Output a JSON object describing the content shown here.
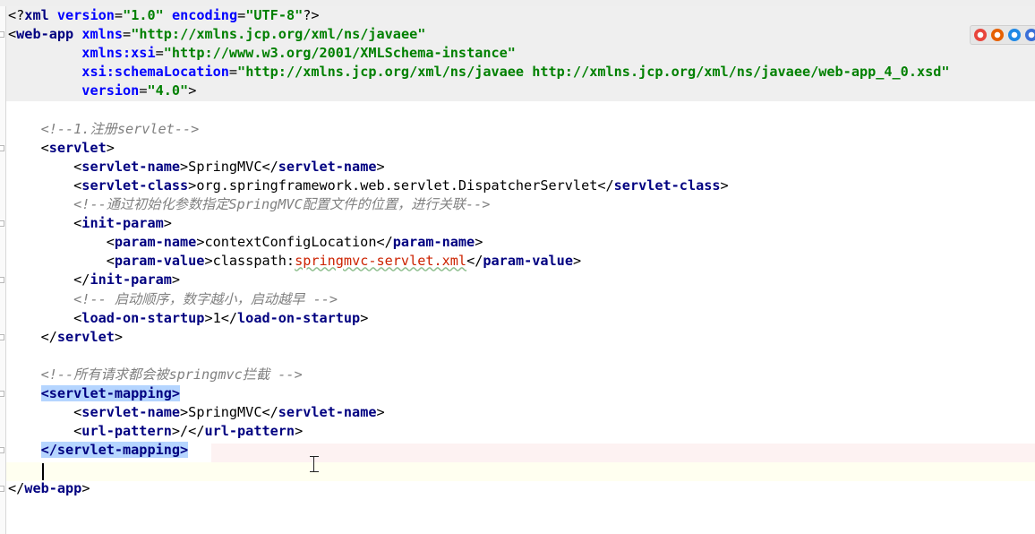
{
  "code_lines": [
    [
      {
        "s": "p",
        "t": "<?"
      },
      {
        "s": "t",
        "t": "xml"
      },
      {
        "s": "p",
        "t": " "
      },
      {
        "s": "a",
        "t": "version"
      },
      {
        "s": "p",
        "t": "="
      },
      {
        "s": "v",
        "t": "\"1.0\""
      },
      {
        "s": "p",
        "t": " "
      },
      {
        "s": "a",
        "t": "encoding"
      },
      {
        "s": "p",
        "t": "="
      },
      {
        "s": "v",
        "t": "\"UTF-8\""
      },
      {
        "s": "p",
        "t": "?>"
      }
    ],
    [
      {
        "s": "p",
        "t": "<"
      },
      {
        "s": "t",
        "t": "web-app"
      },
      {
        "s": "p",
        "t": " "
      },
      {
        "s": "a",
        "t": "xmlns"
      },
      {
        "s": "p",
        "t": "="
      },
      {
        "s": "v",
        "t": "\"http://xmlns.jcp.org/xml/ns/javaee\""
      }
    ],
    [
      {
        "s": "p",
        "t": "         "
      },
      {
        "s": "a",
        "t": "xmlns:xsi"
      },
      {
        "s": "p",
        "t": "="
      },
      {
        "s": "v",
        "t": "\"http://www.w3.org/2001/XMLSchema-instance\""
      }
    ],
    [
      {
        "s": "p",
        "t": "         "
      },
      {
        "s": "a",
        "t": "xsi:schemaLocation"
      },
      {
        "s": "p",
        "t": "="
      },
      {
        "s": "v",
        "t": "\"http://xmlns.jcp.org/xml/ns/javaee http://xmlns.jcp.org/xml/ns/javaee/web-app_4_0.xsd\""
      }
    ],
    [
      {
        "s": "p",
        "t": "         "
      },
      {
        "s": "a",
        "t": "version"
      },
      {
        "s": "p",
        "t": "="
      },
      {
        "s": "v",
        "t": "\"4.0\""
      },
      {
        "s": "p",
        "t": ">"
      }
    ],
    [],
    [
      {
        "s": "p",
        "t": "    "
      },
      {
        "s": "c",
        "t": "<!--1.注册servlet-->"
      }
    ],
    [
      {
        "s": "p",
        "t": "    <"
      },
      {
        "s": "t",
        "t": "servlet"
      },
      {
        "s": "p",
        "t": ">"
      }
    ],
    [
      {
        "s": "p",
        "t": "        <"
      },
      {
        "s": "t",
        "t": "servlet-name"
      },
      {
        "s": "p",
        "t": ">SpringMVC</"
      },
      {
        "s": "t",
        "t": "servlet-name"
      },
      {
        "s": "p",
        "t": ">"
      }
    ],
    [
      {
        "s": "p",
        "t": "        <"
      },
      {
        "s": "t",
        "t": "servlet-class"
      },
      {
        "s": "p",
        "t": ">org.springframework.web.servlet.DispatcherServlet</"
      },
      {
        "s": "t",
        "t": "servlet-class"
      },
      {
        "s": "p",
        "t": ">"
      }
    ],
    [
      {
        "s": "p",
        "t": "        "
      },
      {
        "s": "c",
        "t": "<!--通过初始化参数指定SpringMVC配置文件的位置，进行关联-->"
      }
    ],
    [
      {
        "s": "p",
        "t": "        <"
      },
      {
        "s": "t",
        "t": "init-param"
      },
      {
        "s": "p",
        "t": ">"
      }
    ],
    [
      {
        "s": "p",
        "t": "            <"
      },
      {
        "s": "t",
        "t": "param-name"
      },
      {
        "s": "p",
        "t": ">contextConfigLocation</"
      },
      {
        "s": "t",
        "t": "param-name"
      },
      {
        "s": "p",
        "t": ">"
      }
    ],
    [
      {
        "s": "p",
        "t": "            <"
      },
      {
        "s": "t",
        "t": "param-value"
      },
      {
        "s": "p",
        "t": ">classpath:"
      },
      {
        "s": "rv",
        "t": "springmvc-servlet.xml"
      },
      {
        "s": "p",
        "t": "</"
      },
      {
        "s": "t",
        "t": "param-value"
      },
      {
        "s": "p",
        "t": ">"
      }
    ],
    [
      {
        "s": "p",
        "t": "        </"
      },
      {
        "s": "t",
        "t": "init-param"
      },
      {
        "s": "p",
        "t": ">"
      }
    ],
    [
      {
        "s": "p",
        "t": "        "
      },
      {
        "s": "c",
        "t": "<!-- 启动顺序，数字越小，启动越早 -->"
      }
    ],
    [
      {
        "s": "p",
        "t": "        <"
      },
      {
        "s": "t",
        "t": "load-on-startup"
      },
      {
        "s": "p",
        "t": ">1</"
      },
      {
        "s": "t",
        "t": "load-on-startup"
      },
      {
        "s": "p",
        "t": ">"
      }
    ],
    [
      {
        "s": "p",
        "t": "    </"
      },
      {
        "s": "t",
        "t": "servlet"
      },
      {
        "s": "p",
        "t": ">"
      }
    ],
    [],
    [
      {
        "s": "p",
        "t": "    "
      },
      {
        "s": "c",
        "t": "<!--所有请求都会被springmvc拦截 -->"
      }
    ],
    [
      {
        "s": "p",
        "t": "    "
      },
      {
        "s": "t",
        "t": "<servlet-mapping>",
        "sel": true
      }
    ],
    [
      {
        "s": "p",
        "t": "        <"
      },
      {
        "s": "t",
        "t": "servlet-name"
      },
      {
        "s": "p",
        "t": ">SpringMVC</"
      },
      {
        "s": "t",
        "t": "servlet-name"
      },
      {
        "s": "p",
        "t": ">"
      }
    ],
    [
      {
        "s": "p",
        "t": "        <"
      },
      {
        "s": "t",
        "t": "url-pattern"
      },
      {
        "s": "p",
        "t": ">/</"
      },
      {
        "s": "t",
        "t": "url-pattern"
      },
      {
        "s": "p",
        "t": ">"
      }
    ],
    [
      {
        "s": "p",
        "t": "    "
      },
      {
        "s": "t",
        "t": "</servlet-mapping>",
        "sel": true
      }
    ],
    [],
    [
      {
        "s": "p",
        "t": "</"
      },
      {
        "s": "t",
        "t": "web-app"
      },
      {
        "s": "p",
        "t": ">"
      }
    ]
  ],
  "browser_icons": [
    {
      "name": "chrome-icon",
      "color": "#e8453c"
    },
    {
      "name": "firefox-icon",
      "color": "#e66000"
    },
    {
      "name": "ie-icon",
      "color": "#1e88e5"
    },
    {
      "name": "opera-icon",
      "color": "#3b6fd8"
    }
  ]
}
